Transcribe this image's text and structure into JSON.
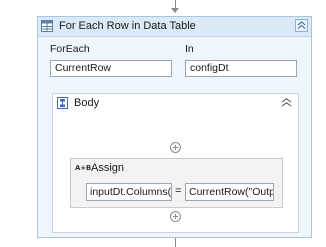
{
  "foreach": {
    "title": "For Each Row in Data Table",
    "foreach_label": "ForEach",
    "foreach_value": "CurrentRow",
    "in_label": "In",
    "in_value": "configDt"
  },
  "body": {
    "title": "Body"
  },
  "assign": {
    "title": "Assign",
    "icon_text": "A+B",
    "left_value": "inputDt.Columns(C",
    "operator": "=",
    "right_value": "CurrentRow(\"Outpu"
  },
  "colors": {
    "container_bg": "#eef5fc",
    "container_border": "#a9c6e0",
    "header_bg": "#dce9f7"
  },
  "icons": [
    "table-icon",
    "collapse-icon",
    "sequence-icon",
    "add-icon",
    "assign-icon"
  ]
}
